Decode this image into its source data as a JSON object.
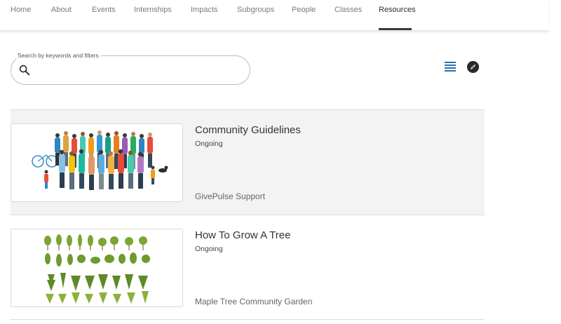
{
  "nav": {
    "items": [
      "Home",
      "About",
      "Events",
      "Internships",
      "Impacts",
      "Subgroups",
      "People",
      "Classes",
      "Resources"
    ],
    "active": "Resources"
  },
  "search": {
    "label": "Search by keywords and filters",
    "value": "",
    "placeholder": ""
  },
  "view_toggle": {
    "list_icon": "list-view-icon",
    "map_icon": "compass-icon"
  },
  "resources": [
    {
      "title": "Community Guidelines",
      "status": "Ongoing",
      "organization": "GivePulse Support",
      "image": "community-crowd-illustration"
    },
    {
      "title": "How To Grow A Tree",
      "status": "Ongoing",
      "organization": "Maple Tree Community Garden",
      "image": "trees-illustration"
    }
  ],
  "colors": {
    "accent_icon": "#2a6fb0",
    "nav_underline": "#3a3a3a",
    "card_alt_bg": "#f3f3f3"
  }
}
